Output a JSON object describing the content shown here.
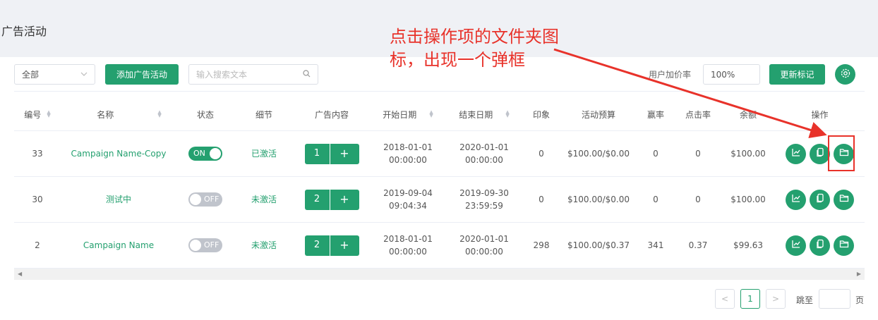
{
  "page": {
    "title": "广告活动"
  },
  "toolbar": {
    "filter_value": "全部",
    "add_button": "添加广告活动",
    "search_placeholder": "输入搜索文本",
    "user_markup_label": "用户加价率",
    "user_markup_value": "100%",
    "update_button": "更新标记"
  },
  "table": {
    "headers": {
      "id": "编号",
      "name": "名称",
      "status": "状态",
      "detail": "细节",
      "content": "广告内容",
      "start": "开始日期",
      "end": "结束日期",
      "impressions": "印象",
      "budget": "活动预算",
      "win_rate": "赢率",
      "ctr": "点击率",
      "balance": "余额",
      "actions": "操作"
    },
    "rows": [
      {
        "id": "33",
        "name": "Campaign Name-Copy",
        "status": "ON",
        "detail": "已激活",
        "content_count": "1",
        "start_date": "2018-01-01",
        "start_time": "00:00:00",
        "end_date": "2020-01-01",
        "end_time": "00:00:00",
        "impressions": "0",
        "budget": "$100.00/$0.00",
        "win_rate": "0",
        "ctr": "0",
        "balance": "$100.00"
      },
      {
        "id": "30",
        "name": "测试中",
        "status": "OFF",
        "detail": "未激活",
        "content_count": "2",
        "start_date": "2019-09-04",
        "start_time": "09:04:34",
        "end_date": "2019-09-30",
        "end_time": "23:59:59",
        "impressions": "0",
        "budget": "$100.00/$0.00",
        "win_rate": "0",
        "ctr": "0",
        "balance": "$100.00"
      },
      {
        "id": "2",
        "name": "Campaign Name",
        "status": "OFF",
        "detail": "未激活",
        "content_count": "2",
        "start_date": "2018-01-01",
        "start_time": "00:00:00",
        "end_date": "2020-01-01",
        "end_time": "00:00:00",
        "impressions": "298",
        "budget": "$100.00/$0.37",
        "win_rate": "341",
        "ctr": "0.37",
        "balance": "$99.63"
      }
    ],
    "plus": "+"
  },
  "pagination": {
    "current": "1",
    "jump_label": "跳至",
    "page_unit": "页",
    "prev": "<",
    "next": ">"
  },
  "annotation": {
    "text": "点击操作项的文件夹图标，出现一个弹框",
    "color": "#e8322a"
  },
  "colors": {
    "accent": "#24a06f",
    "background": "#eff1f5"
  },
  "icons": [
    "chevron-down-icon",
    "search-icon",
    "gear-icon",
    "chart-icon",
    "copy-icon",
    "folder-icon",
    "sort-icon"
  ]
}
